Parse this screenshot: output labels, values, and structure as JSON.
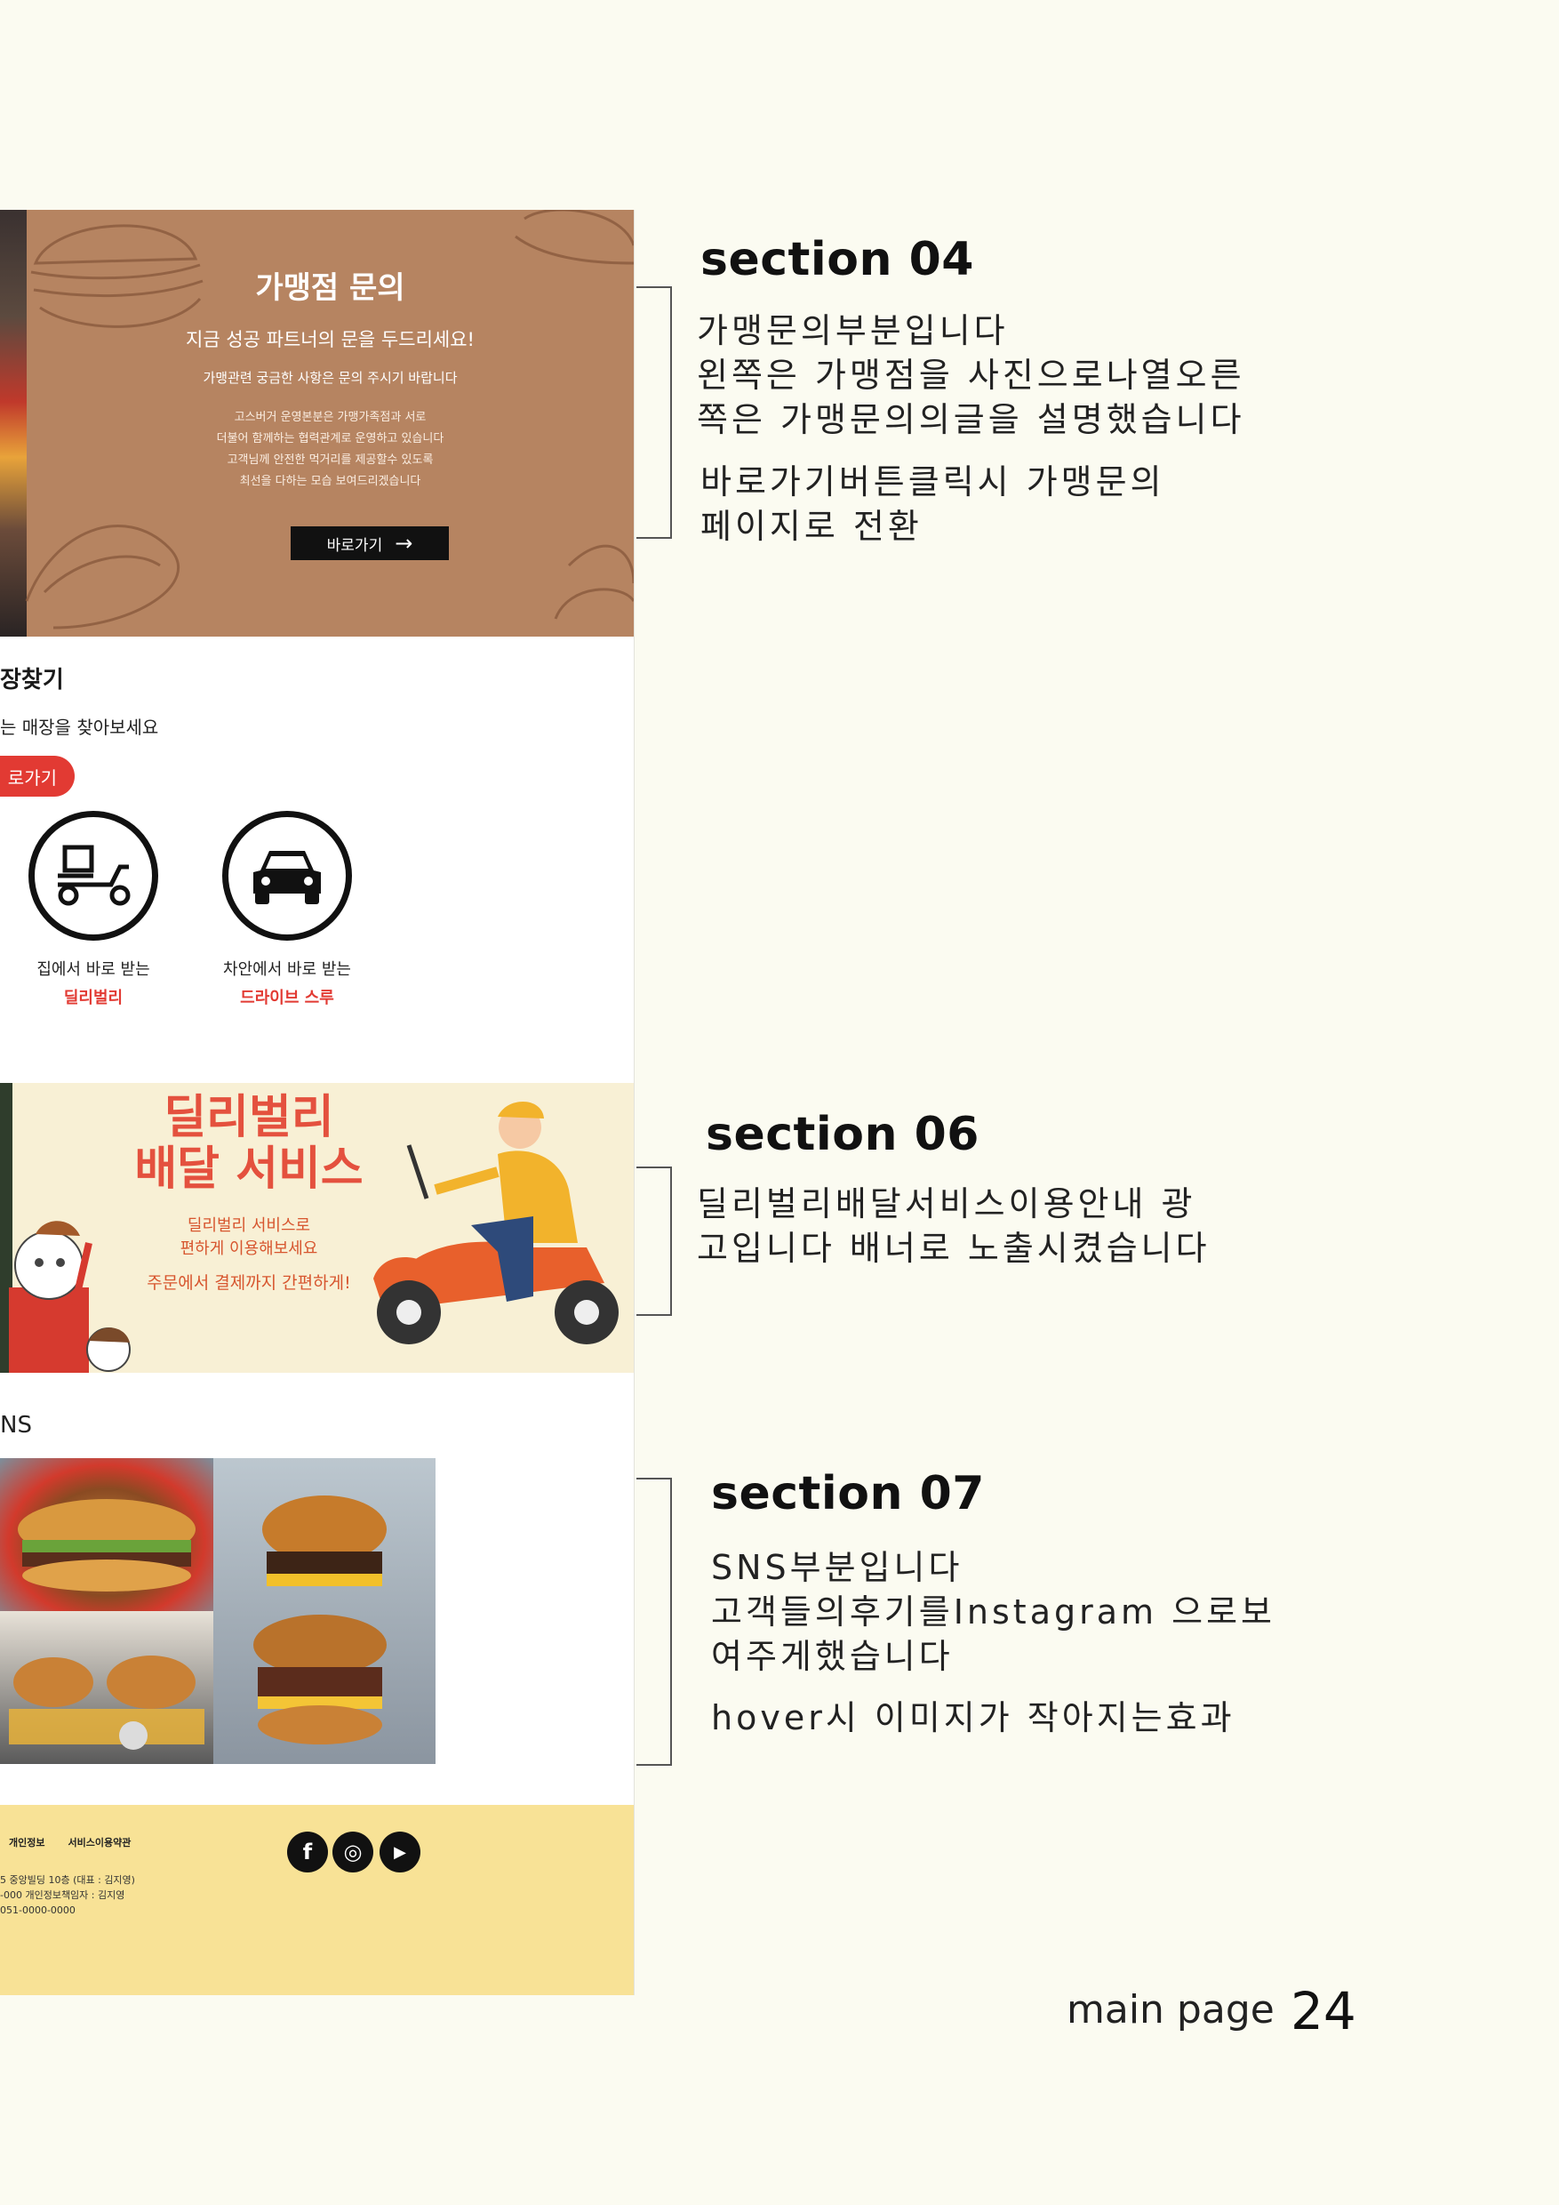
{
  "mockup": {
    "franchise": {
      "title": "가맹점 문의",
      "subtitle": "지금 성공 파트너의 문을 두드리세요!",
      "note": "가맹관련 궁금한 사항은 문의 주시기 바랍니다",
      "body": [
        "고스버거 운영본분은 가맹가족점과 서로",
        "더불어 함께하는 협력관계로 운영하고 있습니다",
        "고객님께 안전한 먹거리를 제공할수 있도록",
        "최선을 다하는 모습 보여드리겠습니다"
      ],
      "button": "바로가기",
      "arrow": "→"
    },
    "store": {
      "title": "장찾기",
      "subtitle": "는 매장을 찾아보세요",
      "button": "로가기",
      "services": [
        {
          "line1": "집에서 바로 받는",
          "line2": "딜리벌리",
          "icon": "scooter-icon"
        },
        {
          "line1": "차안에서 바로 받는",
          "line2": "드라이브 스루",
          "icon": "car-icon"
        }
      ]
    },
    "delivery": {
      "title1": "딜리벌리",
      "title2": "배달 서비스",
      "sub1": "딜리벌리 서비스로",
      "sub2": "편하게 이용해보세요",
      "line": "주문에서 결제까지 간편하게!"
    },
    "sns": {
      "label": "NS"
    },
    "footer": {
      "links": [
        "개인정보",
        "서비스이용약관"
      ],
      "info": [
        "5 중앙빌딩 10층 (대표 : 김지영)",
        "-000    개인정보책임자 : 김지영",
        "051-0000-0000"
      ],
      "social": [
        {
          "icon": "facebook-icon",
          "glyph": "f"
        },
        {
          "icon": "instagram-icon",
          "glyph": "◎"
        },
        {
          "icon": "youtube-icon",
          "glyph": "▶"
        }
      ]
    }
  },
  "annotations": [
    {
      "title": "section 04",
      "body": [
        "가맹문의부분입니다",
        "왼쪽은 가맹점을 사진으로나열오른",
        "쪽은 가맹문의의글을 설명했습니다"
      ],
      "extra": [
        "바로가기버튼클릭시 가맹문의",
        "페이지로 전환"
      ]
    },
    {
      "title": "section 06",
      "body": [
        "딜리벌리배달서비스이용안내 광",
        "고입니다  배너로 노출시켰습니다"
      ],
      "extra": []
    },
    {
      "title": "section 07",
      "body": [
        "SNS부분입니다",
        "고객들의후기를Instagram 으로보",
        "여주게했습니다"
      ],
      "extra": [
        "hover시 이미지가 작아지는효과"
      ]
    }
  ],
  "page": {
    "label": "main page",
    "number": "24"
  },
  "colors": {
    "background": "#fbfbf1",
    "franchise": "#b68461",
    "accent": "#e23a33",
    "footer": "#f8e296",
    "delivery": "#f8f0d5"
  }
}
